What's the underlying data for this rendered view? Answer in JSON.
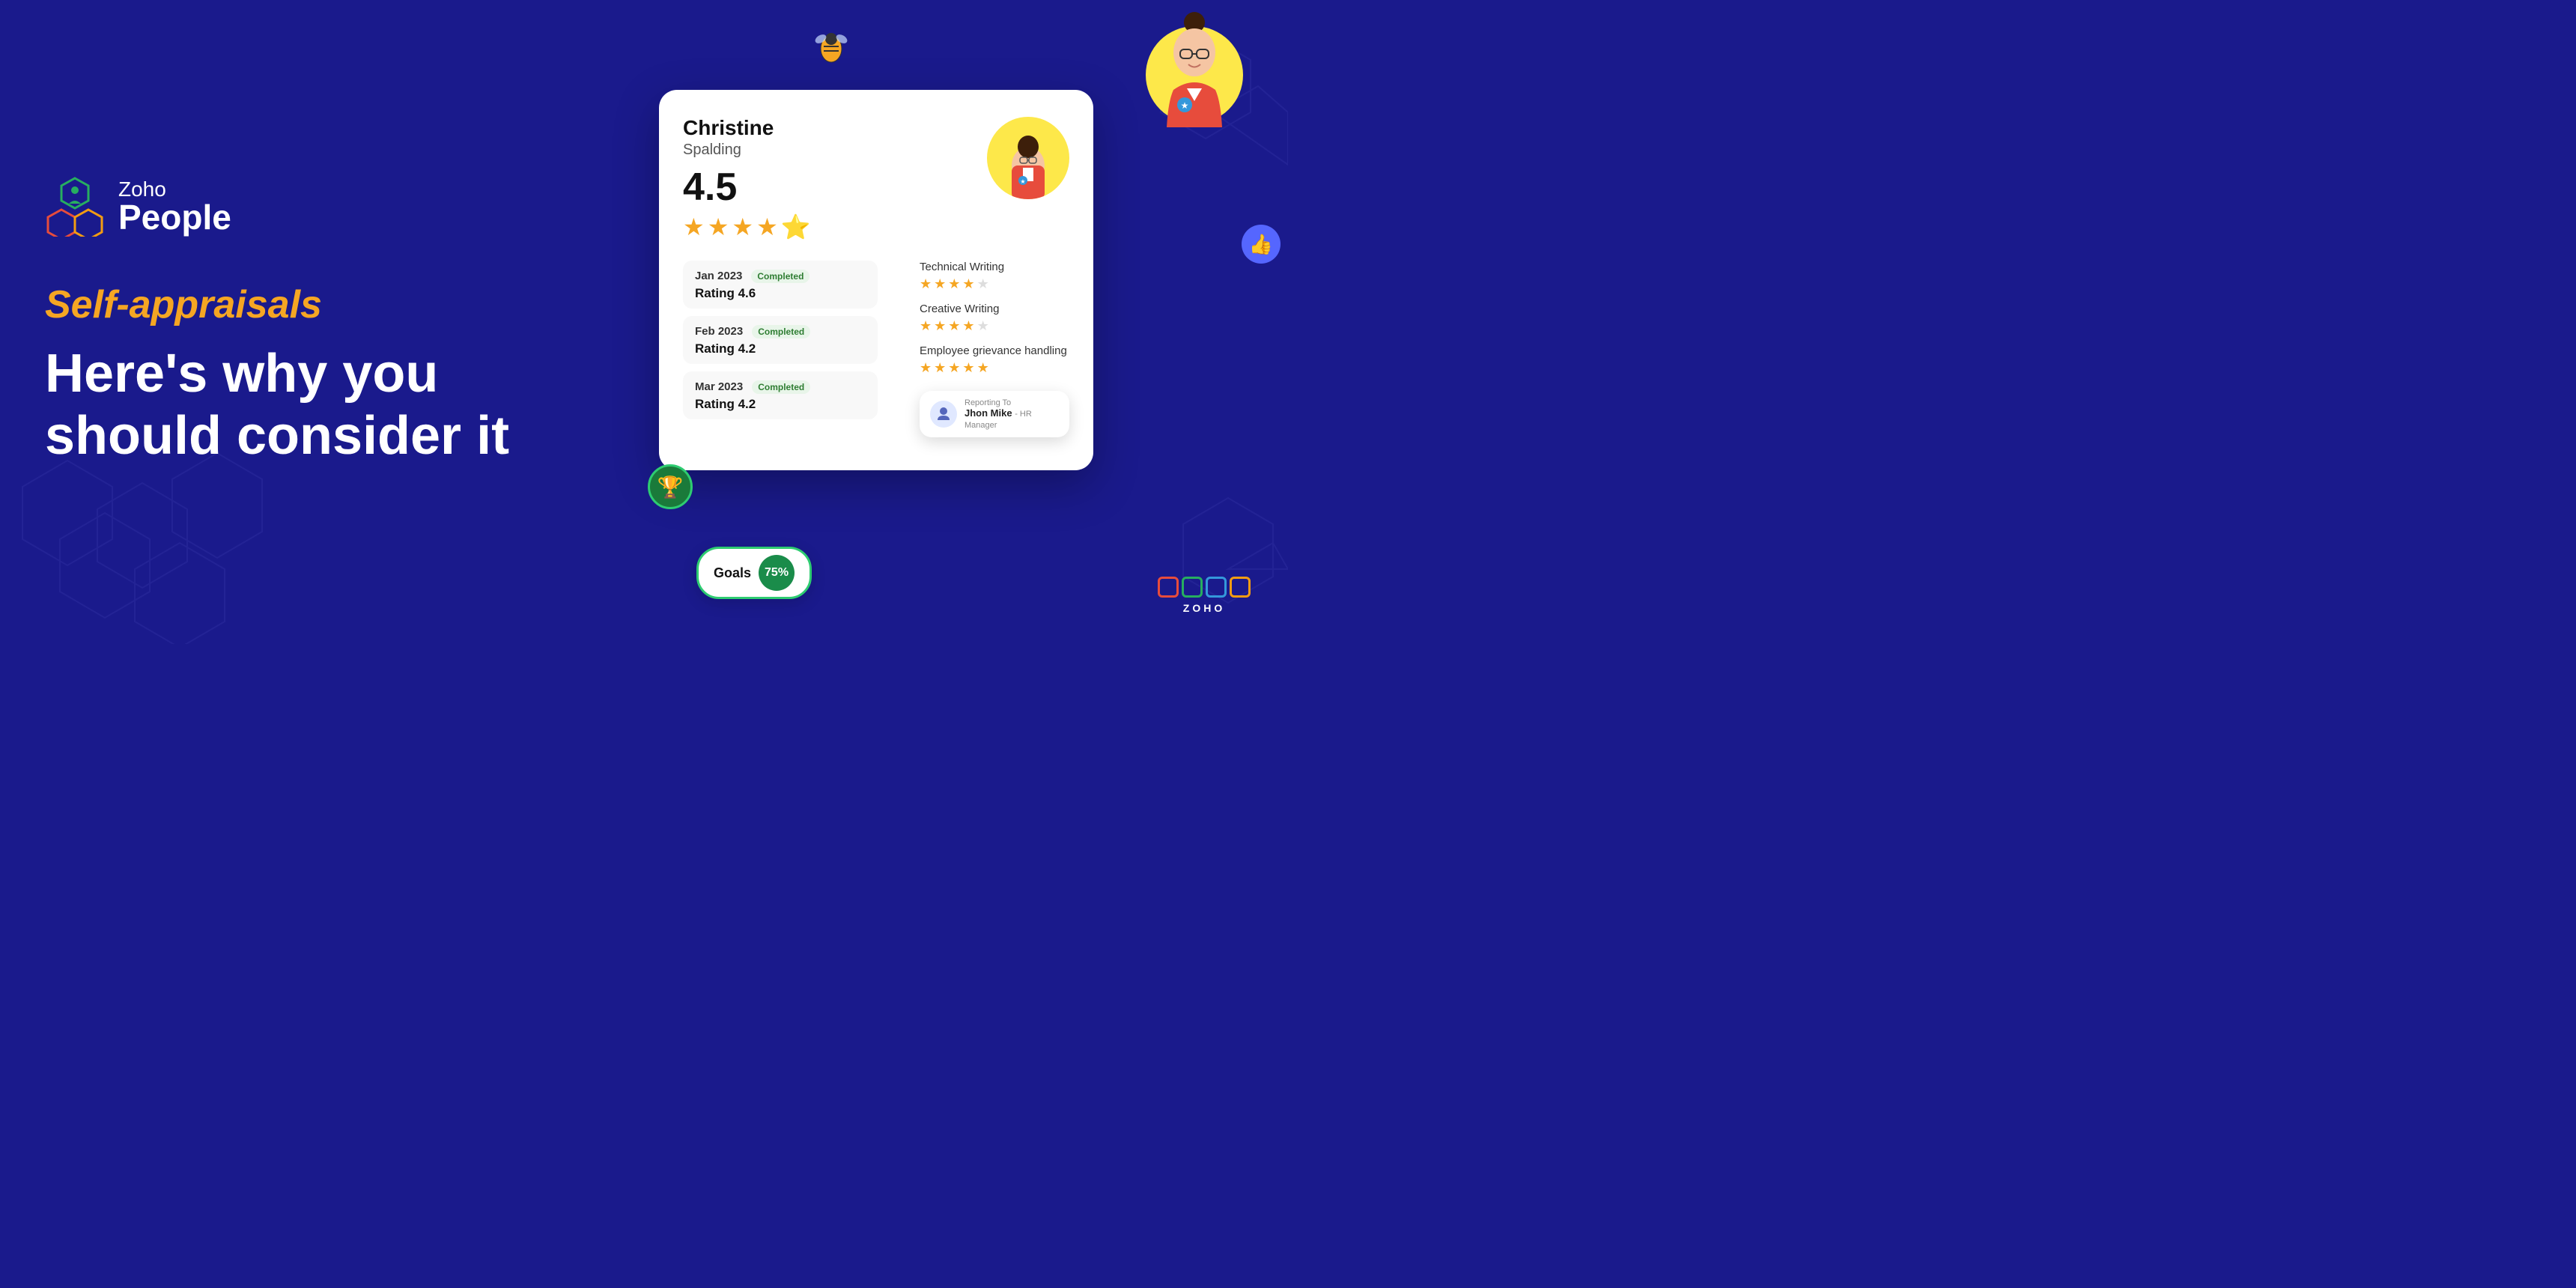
{
  "brand": {
    "zoho": "Zoho",
    "people": "People"
  },
  "hero": {
    "tagline_script": "Self-appraisals",
    "tagline_main_line1": "Here's why you",
    "tagline_main_line2": "should consider it"
  },
  "card": {
    "person": {
      "first_name": "Christine",
      "last_name": "Spalding"
    },
    "overall_rating": "4.5",
    "stars": [
      {
        "type": "full"
      },
      {
        "type": "full"
      },
      {
        "type": "full"
      },
      {
        "type": "full"
      },
      {
        "type": "half"
      }
    ],
    "appraisals": [
      {
        "month": "Jan 2023",
        "status": "Completed",
        "rating_label": "Rating 4.6"
      },
      {
        "month": "Feb 2023",
        "status": "Completed",
        "rating_label": "Rating 4.2"
      },
      {
        "month": "Mar 2023",
        "status": "Completed",
        "rating_label": "Rating 4.2"
      }
    ],
    "skills": [
      {
        "name": "Technical Writing",
        "stars": [
          true,
          true,
          true,
          true,
          false
        ]
      },
      {
        "name": "Creative Writing",
        "stars": [
          true,
          true,
          true,
          true,
          false
        ]
      },
      {
        "name": "Employee grievance handling",
        "stars": [
          true,
          true,
          true,
          true,
          true
        ]
      }
    ],
    "goals": {
      "label": "Goals",
      "percent": "75%"
    },
    "reporting": {
      "label": "Reporting To",
      "name": "Jhon Mike",
      "role": "HR Manager"
    }
  },
  "zoho_brand": {
    "label": "ZOHO",
    "box_colors": [
      "#e74c3c",
      "#27ae60",
      "#3498db",
      "#f39c12"
    ]
  }
}
